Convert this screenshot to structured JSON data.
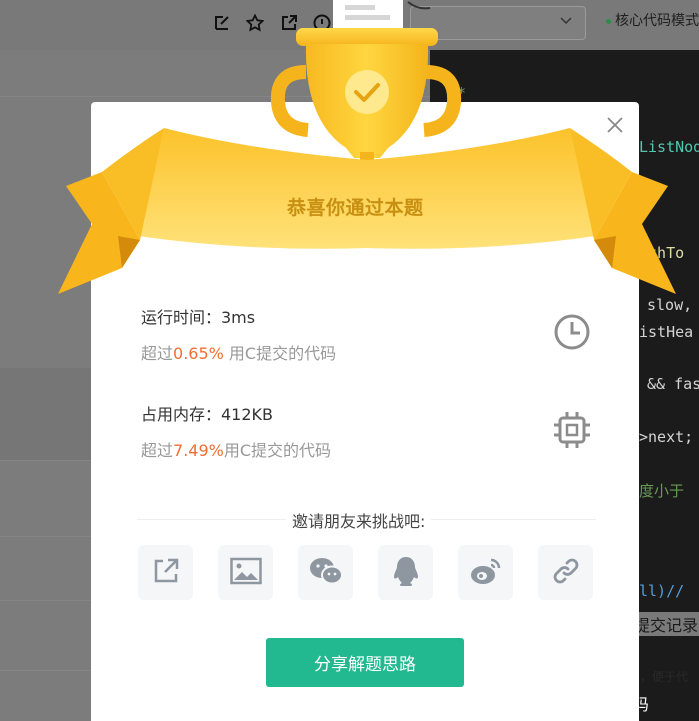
{
  "background": {
    "mode_label": "核心代码模式",
    "code_lines": [
      {
        "text": "**",
        "color": "#6a9955"
      },
      {
        "text": "ListNod",
        "color": "#4ec9b0"
      },
      {
        "text": "athTo",
        "color": "#dcdcaa"
      },
      {
        "text": "slow,",
        "color": "#d4d4d4"
      },
      {
        "text": "istHea",
        "color": "#d4d4d4"
      },
      {
        "text": "&& fas",
        "color": "#d4d4d4"
      },
      {
        "text": ">next;",
        "color": "#d4d4d4"
      },
      {
        "text": "度小于",
        "color": "#6a9955"
      },
      {
        "text": "ll)//",
        "color": "#569cd6"
      }
    ],
    "submit_record": "提交记录",
    "tip_text": "，便于代",
    "watermark": "CSDN @小张在努力写代码"
  },
  "modal": {
    "title": "恭喜你通过本题",
    "runtime": {
      "label": "运行时间：3ms",
      "prefix": "超过",
      "percent": "0.65%",
      "suffix": " 用C提交的代码"
    },
    "memory": {
      "label": "占用内存：412KB",
      "prefix": "超过",
      "percent": "7.49%",
      "suffix": "用C提交的代码"
    },
    "invite": "邀请朋友来挑战吧:",
    "share_icons": [
      "external-link-icon",
      "image-icon",
      "wechat-icon",
      "qq-icon",
      "weibo-icon",
      "link-icon"
    ],
    "primary_button": "分享解题思路"
  },
  "colors": {
    "accent": "#22b890",
    "highlight": "#f06e34",
    "gold": "#fcc72c",
    "ribbon_text": "#c89012"
  }
}
